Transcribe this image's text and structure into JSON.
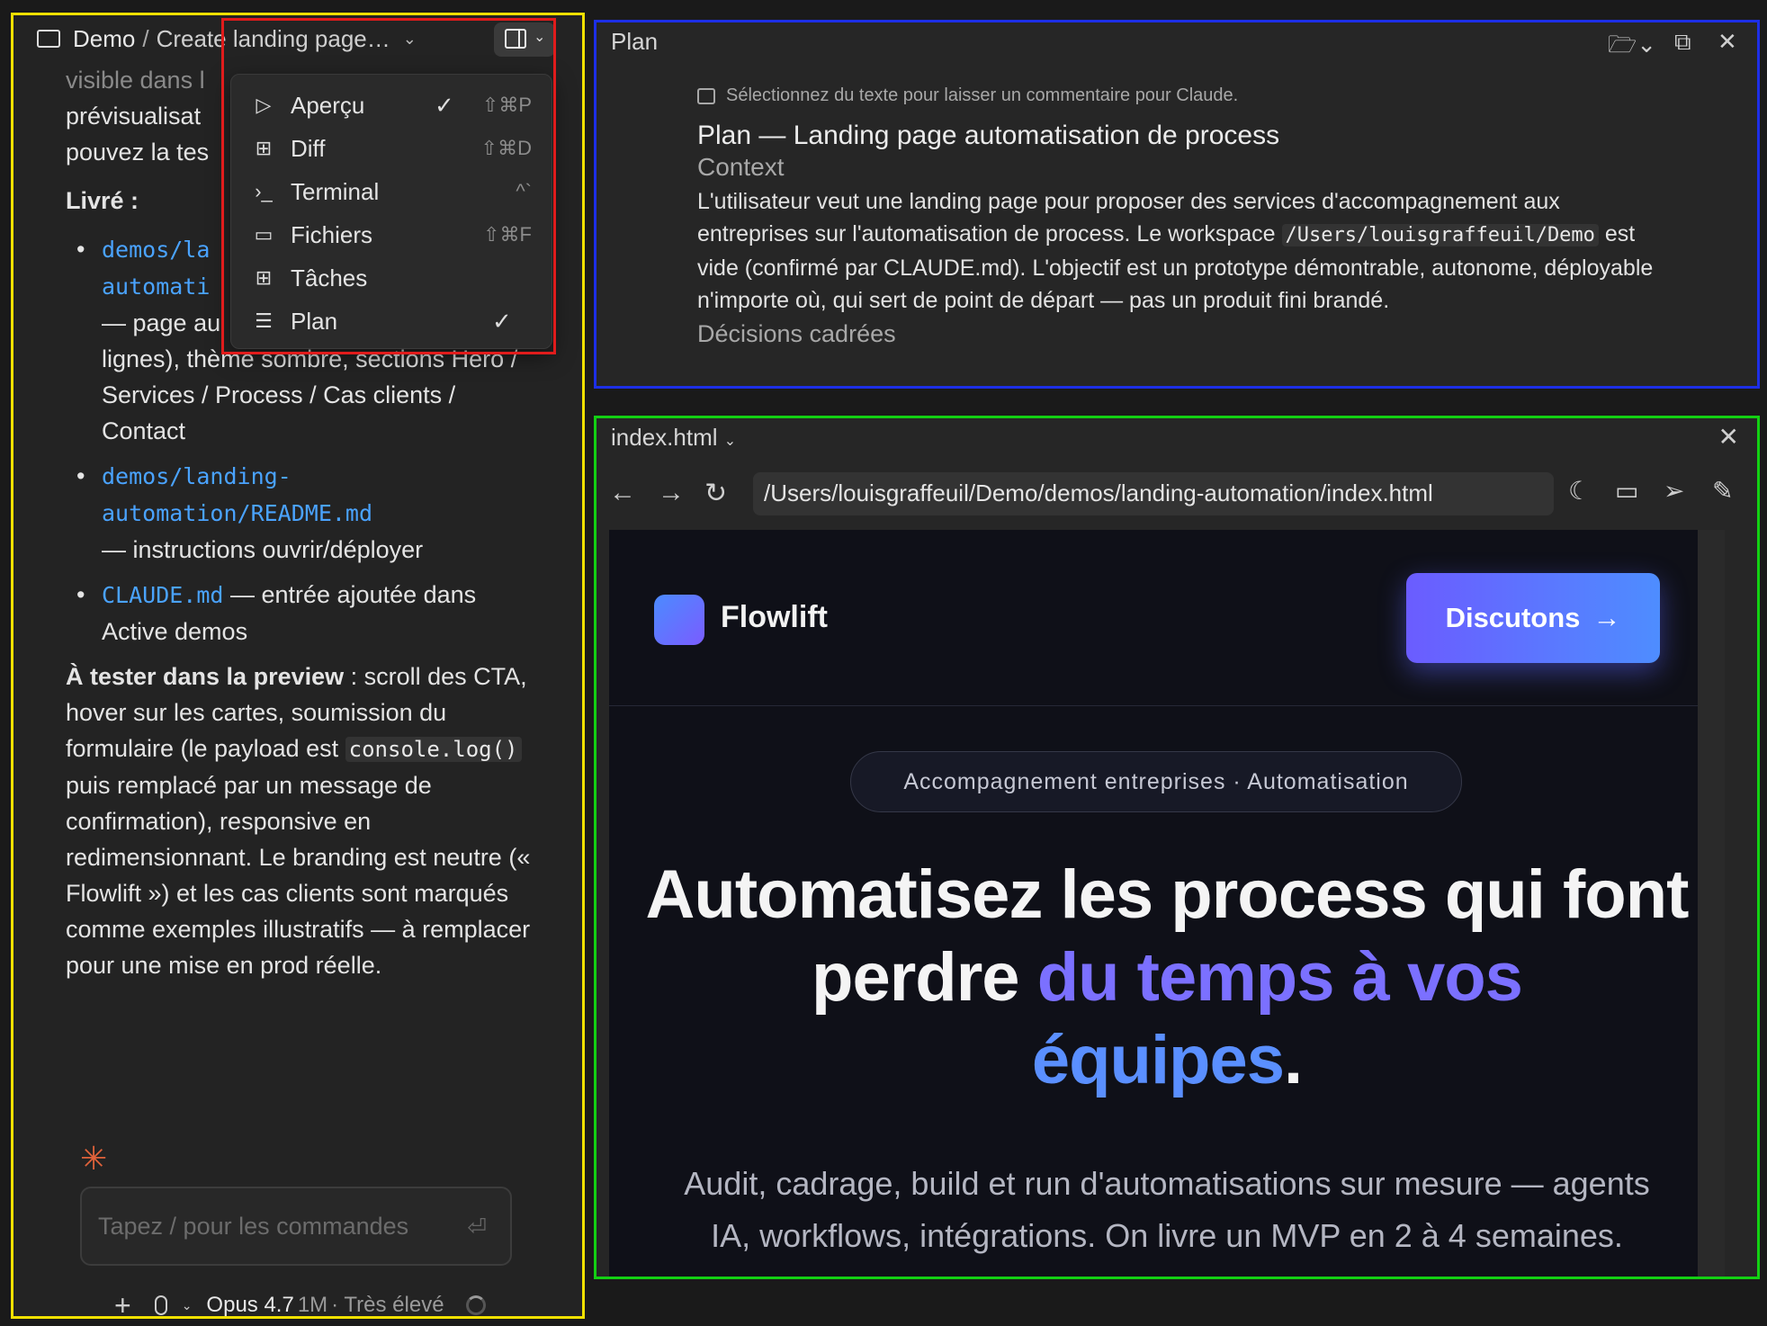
{
  "left": {
    "crumb_root": "Demo",
    "crumb_sep": "/",
    "crumb_title": "Create landing page…",
    "chat": {
      "faded_line": "visible dans l",
      "line1": "prévisualisat",
      "line2": "pouvez la tes",
      "delivered_label": "Livré :",
      "items": [
        {
          "path_a": "demos/la",
          "path_b": "automati",
          "desc": "— page au",
          "desc2": "lignes), thème sombre, sections Hero / Services / Process / Cas clients / Contact"
        },
        {
          "path_a": "demos/landing-",
          "path_b": "automation/README.md",
          "desc": "— instructions ouvrir/déployer"
        },
        {
          "path_a": "CLAUDE.md",
          "desc": "— entrée ajoutée dans Active demos"
        }
      ],
      "test_bold": "À tester dans la preview",
      "test_text_1": " : scroll des CTA, hover sur les cartes, soumission du formulaire (le payload est ",
      "test_code": "console.log()",
      "test_text_2": " puis remplacé par un message de confirmation), responsive en redimensionnant. Le branding est neutre (« Flowlift ») et les cas clients sont marqués comme exemples illustratifs — à remplacer pour une mise en prod réelle."
    },
    "input_placeholder": "Tapez / pour les commandes",
    "model": "Opus 4.7",
    "context": "1M",
    "effort": "· Très élevé"
  },
  "menu": {
    "items": [
      {
        "label": "Aperçu",
        "icon": "▷",
        "checked": "✓",
        "shortcut": "⇧⌘P"
      },
      {
        "label": "Diff",
        "icon": "⊞",
        "checked": "",
        "shortcut": "⇧⌘D"
      },
      {
        "label": "Terminal",
        "icon": "›_",
        "checked": "",
        "shortcut": "^`"
      },
      {
        "label": "Fichiers",
        "icon": "▭",
        "checked": "",
        "shortcut": "⇧⌘F"
      },
      {
        "label": "Tâches",
        "icon": "⊞",
        "checked": "",
        "shortcut": ""
      },
      {
        "label": "Plan",
        "icon": "☰",
        "checked": "✓",
        "shortcut": ""
      }
    ]
  },
  "plan": {
    "title": "Plan",
    "hint": "Sélectionnez du texte pour laisser un commentaire pour Claude.",
    "heading": "Plan — Landing page automatisation de process",
    "context_label": "Context",
    "text_1": "L'utilisateur veut une landing page pour proposer des services d'accompagnement aux entreprises sur l'automatisation de process. Le workspace ",
    "text_code": "/Users/louisgraffeuil/Demo",
    "text_2": " est vide (confirmé par CLAUDE.md). L'objectif est un prototype démontrable, autonome, déployable n'importe où, qui sert de point de départ — pas un produit fini brandé.",
    "decisions_label": "Décisions cadrées"
  },
  "preview": {
    "tab": "index.html",
    "url": "/Users/louisgraffeuil/Demo/demos/landing-automation/index.html",
    "site": {
      "logo": "Flowlift",
      "cta": "Discutons",
      "cta_arrow": "→",
      "pill": "Accompagnement entreprises · Automatisation",
      "title_1": "Automatisez les process qui font perdre ",
      "title_grad_1": "du temps à vos",
      "title_grad_2": "équipes",
      "title_end": ".",
      "subtitle": "Audit, cadrage, build et run d'automatisations sur mesure — agents IA, workflows, intégrations. On livre un MVP en 2 à 4 semaines."
    }
  },
  "colors": {
    "highlight_menu": "#e01c1c",
    "highlight_plan": "#1d2fe6",
    "highlight_preview": "#13d013",
    "highlight_chat": "#f0e000",
    "link": "#4aa3ff",
    "cta_start": "#6b5cff",
    "cta_end": "#4e8dff"
  }
}
